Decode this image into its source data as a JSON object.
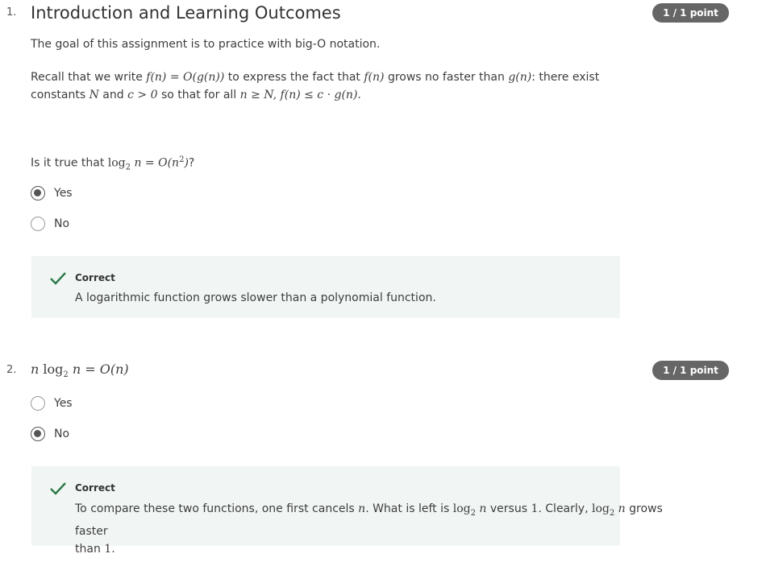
{
  "q1": {
    "number": "1.",
    "title": "Introduction and Learning Outcomes",
    "points": "1 / 1 point",
    "intro": "The goal of this assignment is to practice with big-O notation.",
    "recall_a": "Recall that we write ",
    "m_fdef": "f(n) = O(g(n))",
    "recall_b": " to express the fact that ",
    "m_fn": "f(n)",
    "recall_c": " grows no faster than ",
    "m_gn": "g(n)",
    "recall_d": ": there exist",
    "recall_e": "constants ",
    "m_N": "N",
    "recall_f": " and ",
    "m_c0": "c > 0",
    "recall_g": " so that for all ",
    "m_cond": "n ≥ N, f(n) ≤ c · g(n).",
    "question_a": "Is it true that ",
    "m_log": "log",
    "m_base": "2",
    "m_q": " n = O(n",
    "m_exp": "2",
    "m_close": ")",
    "question_end": "?",
    "options": [
      "Yes",
      "No"
    ],
    "feedback_title": "Correct",
    "feedback_text": "A logarithmic function grows slower than a polynomial function."
  },
  "q2": {
    "number": "2.",
    "m_n": "n",
    "m_log": "log",
    "m_base": "2",
    "m_rest": " n = O(n)",
    "points": "1 / 1 point",
    "options": [
      "Yes",
      "No"
    ],
    "feedback_title": "Correct",
    "fb_a": "To compare these two functions, one first cancels ",
    "m_n2": "n",
    "fb_b": ". What is left is ",
    "m_log2": "log",
    "m_base2": "2",
    "m_n3": " n",
    "fb_c": " versus ",
    "m_one": "1",
    "fb_d": ". Clearly, ",
    "m_log3": "log",
    "m_base3": "2",
    "m_n4": " n",
    "fb_e": " grows faster",
    "fb_f": "than ",
    "m_one2": "1",
    "fb_g": "."
  }
}
